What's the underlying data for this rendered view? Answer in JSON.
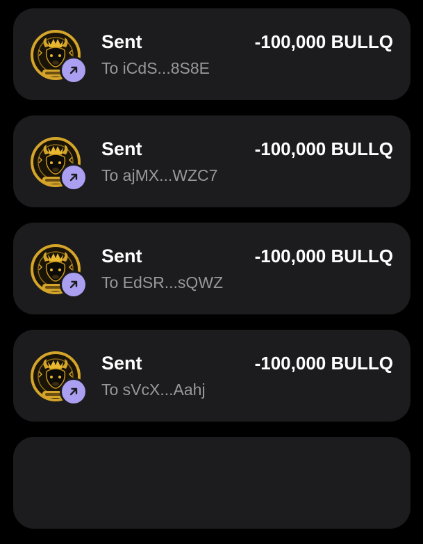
{
  "colors": {
    "background": "#000000",
    "card": "#1c1c1e",
    "badge": "#ab9ff2",
    "primary_text": "#ffffff",
    "secondary_text": "#999999",
    "logo_gold": "#d4a52a"
  },
  "token_logo": {
    "arc_text": "THE BULL QUEEN",
    "ticker_text": "$BULLQ"
  },
  "transactions": [
    {
      "title": "Sent",
      "counterparty": "To iCdS...8S8E",
      "amount": "-100,000 BULLQ",
      "icon": "arrow-up-right-icon"
    },
    {
      "title": "Sent",
      "counterparty": "To ajMX...WZC7",
      "amount": "-100,000 BULLQ",
      "icon": "arrow-up-right-icon"
    },
    {
      "title": "Sent",
      "counterparty": "To EdSR...sQWZ",
      "amount": "-100,000 BULLQ",
      "icon": "arrow-up-right-icon"
    },
    {
      "title": "Sent",
      "counterparty": "To sVcX...Aahj",
      "amount": "-100,000 BULLQ",
      "icon": "arrow-up-right-icon"
    }
  ]
}
